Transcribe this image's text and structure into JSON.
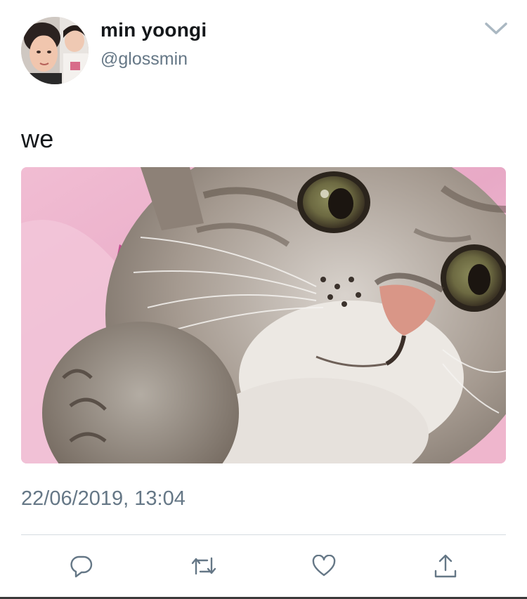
{
  "tweet": {
    "author": {
      "display_name": "min yoongi",
      "handle": "@glossmin"
    },
    "text": "we",
    "timestamp": "22/06/2019, 13:04",
    "media": {
      "kind": "photo",
      "subject": "tabby kitten on pink blanket"
    }
  },
  "icons": {
    "menu": "chevron-down-icon",
    "reply": "reply-icon",
    "retweet": "retweet-icon",
    "like": "heart-icon",
    "share": "share-icon"
  },
  "colors": {
    "text_primary": "#14171a",
    "text_secondary": "#657786",
    "icon": "#657786",
    "divider": "#d5dce0"
  }
}
